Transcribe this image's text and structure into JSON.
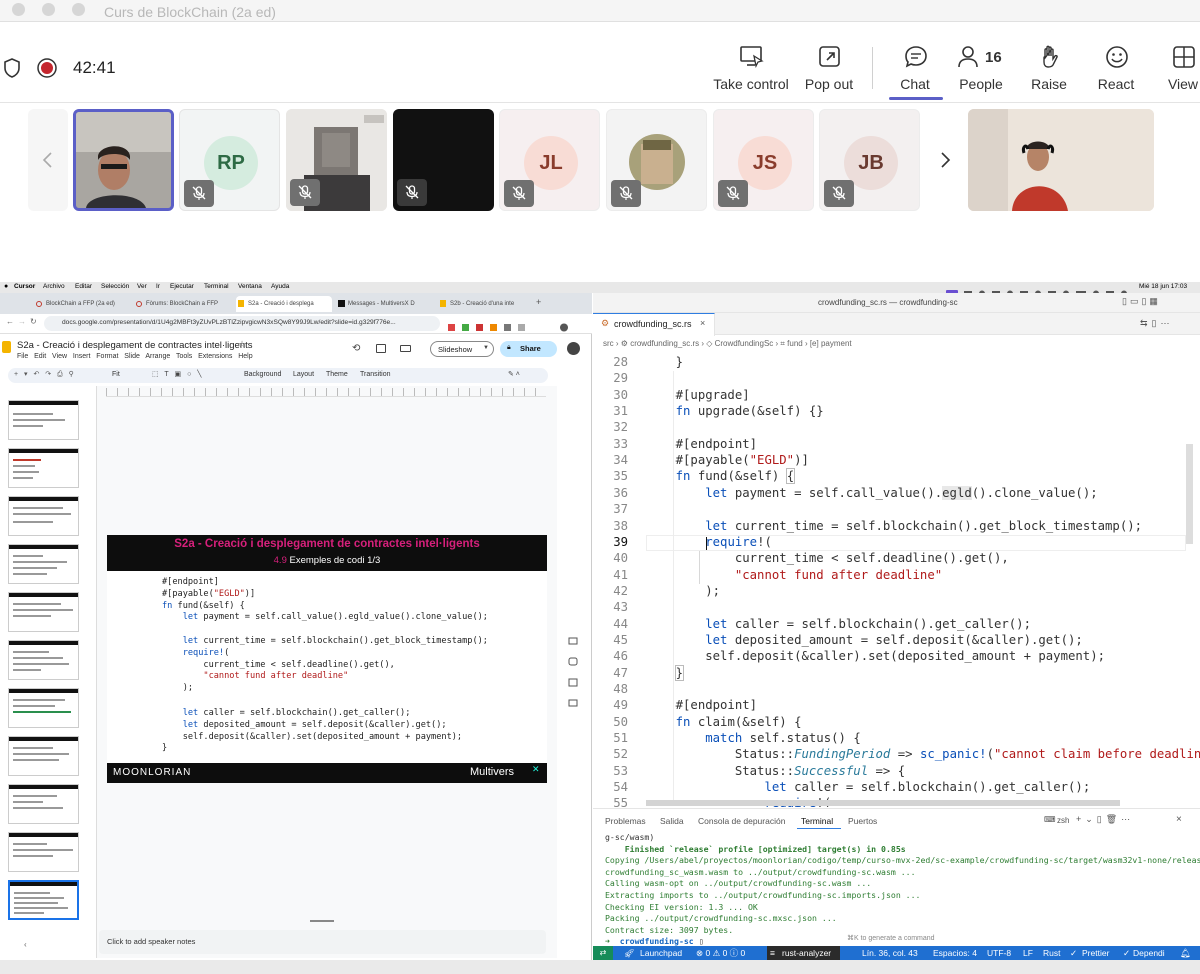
{
  "meeting": {
    "title": "Curs de BlockChain (2a ed)",
    "timer": "42:41"
  },
  "toolbar": {
    "take_control": "Take control",
    "pop_out": "Pop out",
    "chat": "Chat",
    "people": "People",
    "people_count": "16",
    "raise": "Raise",
    "react": "React",
    "view": "View"
  },
  "participants": [
    "RP",
    "JL",
    "JS",
    "JB"
  ],
  "mac_menu": {
    "app": "Cursor",
    "items": [
      "Archivo",
      "Editar",
      "Selección",
      "Ver",
      "Ir",
      "Ejecutar",
      "Terminal",
      "Ventana",
      "Ayuda"
    ],
    "clock": "Mié 18 jun 17:03"
  },
  "browser": {
    "tabs": [
      "BlockChain a FFP (2a ed)",
      "Fòrums: BlockChain a FFP",
      "S2a - Creació i desplega",
      "Messages - MultiversX D",
      "S2b - Creació d'una inte"
    ],
    "url": "docs.google.com/presentation/d/1U4g2MBFt3yZUvPLzBTlZzipvgicwN3xSQw8Y99J9Lw/edit?slide=id.g329f776e..."
  },
  "slides": {
    "doc_title": "S2a - Creació i desplegament de contractes intel·ligents",
    "menu": [
      "File",
      "Edit",
      "View",
      "Insert",
      "Format",
      "Slide",
      "Arrange",
      "Tools",
      "Extensions",
      "Help"
    ],
    "slideshow": "Slideshow",
    "share": "Share",
    "tool_items": [
      "Fit",
      "Background",
      "Layout",
      "Theme",
      "Transition"
    ],
    "slide_title": "S2a - Creació i desplegament de contractes intel·ligents",
    "slide_subtitle_num": "4.9",
    "slide_subtitle": "Exemples de codi 1/3",
    "footer_left": "MOONLORIAN",
    "footer_right": "Multivers",
    "notes": "Click to add speaker notes"
  },
  "editor": {
    "window_title": "crowdfunding_sc.rs — crowdfunding-sc",
    "tab": "crowdfunding_sc.rs",
    "breadcrumb": [
      "src",
      "crowdfunding_sc.rs",
      "CrowdfundingSc",
      "fund",
      "payment"
    ],
    "line_numbers": [
      "28",
      "29",
      "30",
      "31",
      "32",
      "33",
      "34",
      "35",
      "36",
      "37",
      "38",
      "39",
      "40",
      "41",
      "42",
      "43",
      "44",
      "45",
      "46",
      "47",
      "48",
      "49",
      "50",
      "51",
      "52",
      "53",
      "54",
      "55"
    ]
  },
  "panel": {
    "tabs": [
      "Problemas",
      "Salida",
      "Consola de depuración",
      "Terminal",
      "Puertos"
    ],
    "shell": "zsh",
    "lines": [
      "g-sc/wasm)",
      "    Finished `release` profile [optimized] target(s) in 0.85s",
      "Copying /Users/abel/proyectos/moonlorian/codigo/temp/curso-mvx-2ed/sc-example/crowdfunding-sc/target/wasm32v1-none/release/",
      "crowdfunding_sc_wasm.wasm to ../output/crowdfunding-sc.wasm ...",
      "Calling wasm-opt on ../output/crowdfunding-sc.wasm ...",
      "Extracting imports to ../output/crowdfunding-sc.imports.json ...",
      "Checking EI version: 1.3 ... OK",
      "Packing ../output/crowdfunding-sc.mxsc.json ...",
      "Contract size: 3097 bytes."
    ],
    "prompt": "crowdfunding-sc",
    "hint": "⌘K to generate a command"
  },
  "status": {
    "launchpad": "Launchpad",
    "errors": "0",
    "warnings": "0",
    "info": "0",
    "analyzer": "rust-analyzer",
    "position": "Lín. 36, col. 43",
    "spaces": "Espacios: 4",
    "encoding": "UTF-8",
    "eol": "LF",
    "lang": "Rust",
    "prettier": "Prettier",
    "depend": "Dependi"
  }
}
